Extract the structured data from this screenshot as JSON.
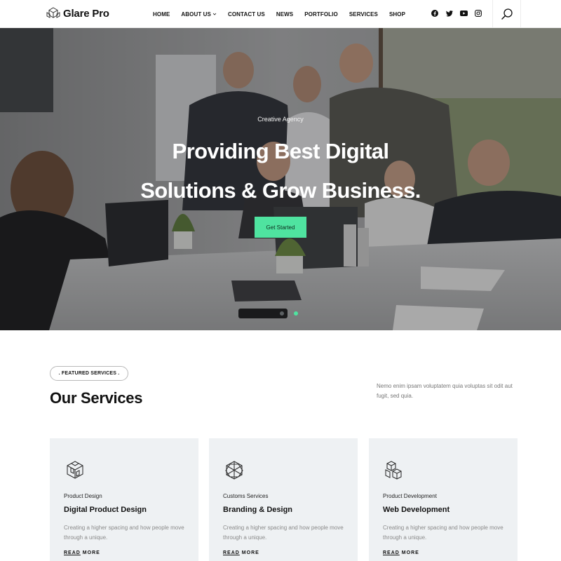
{
  "brand": {
    "name": "Glare Pro"
  },
  "nav": {
    "items": [
      {
        "label": "HOME"
      },
      {
        "label": "ABOUT US",
        "has_dropdown": true
      },
      {
        "label": "CONTACT US"
      },
      {
        "label": "NEWS"
      },
      {
        "label": "PORTFOLIO"
      },
      {
        "label": "SERVICES"
      },
      {
        "label": "SHOP"
      }
    ],
    "socials": [
      "facebook-icon",
      "twitter-icon",
      "youtube-icon",
      "instagram-icon"
    ],
    "search_icon": "search-icon"
  },
  "hero": {
    "eyebrow": "Creative Agency",
    "title_line1": "Providing Best Digital",
    "title_line2": "Solutions & Grow Business.",
    "cta": "Get Started",
    "active_slide": 2,
    "slide_count": 2
  },
  "services": {
    "pill": ". FEATURED SERVICES .",
    "title": "Our Services",
    "description": "Nemo enim ipsam voluptatem quia voluptas sit odit aut fugit, sed quia.",
    "cards": [
      {
        "category": "Product Design",
        "title": "Digital Product Design",
        "desc": "Creating a higher spacing and how people move through a unique.",
        "link_a": "READ",
        "link_b": " MORE",
        "icon": "cube-box-icon"
      },
      {
        "category": "Customs Services",
        "title": "Branding & Design",
        "desc": "Creating a higher spacing and how people move through a unique.",
        "link_a": "READ",
        "link_b": " MORE",
        "icon": "star-polygon-icon"
      },
      {
        "category": "Product Development",
        "title": "Web Development",
        "desc": "Creating a higher spacing and how people move through a unique.",
        "link_a": "READ",
        "link_b": " MORE",
        "icon": "cube-stack-icon"
      }
    ]
  },
  "colors": {
    "accent": "#4fe3a0",
    "dot_active": "#4fe3a0",
    "card_bg": "#eef1f3"
  }
}
